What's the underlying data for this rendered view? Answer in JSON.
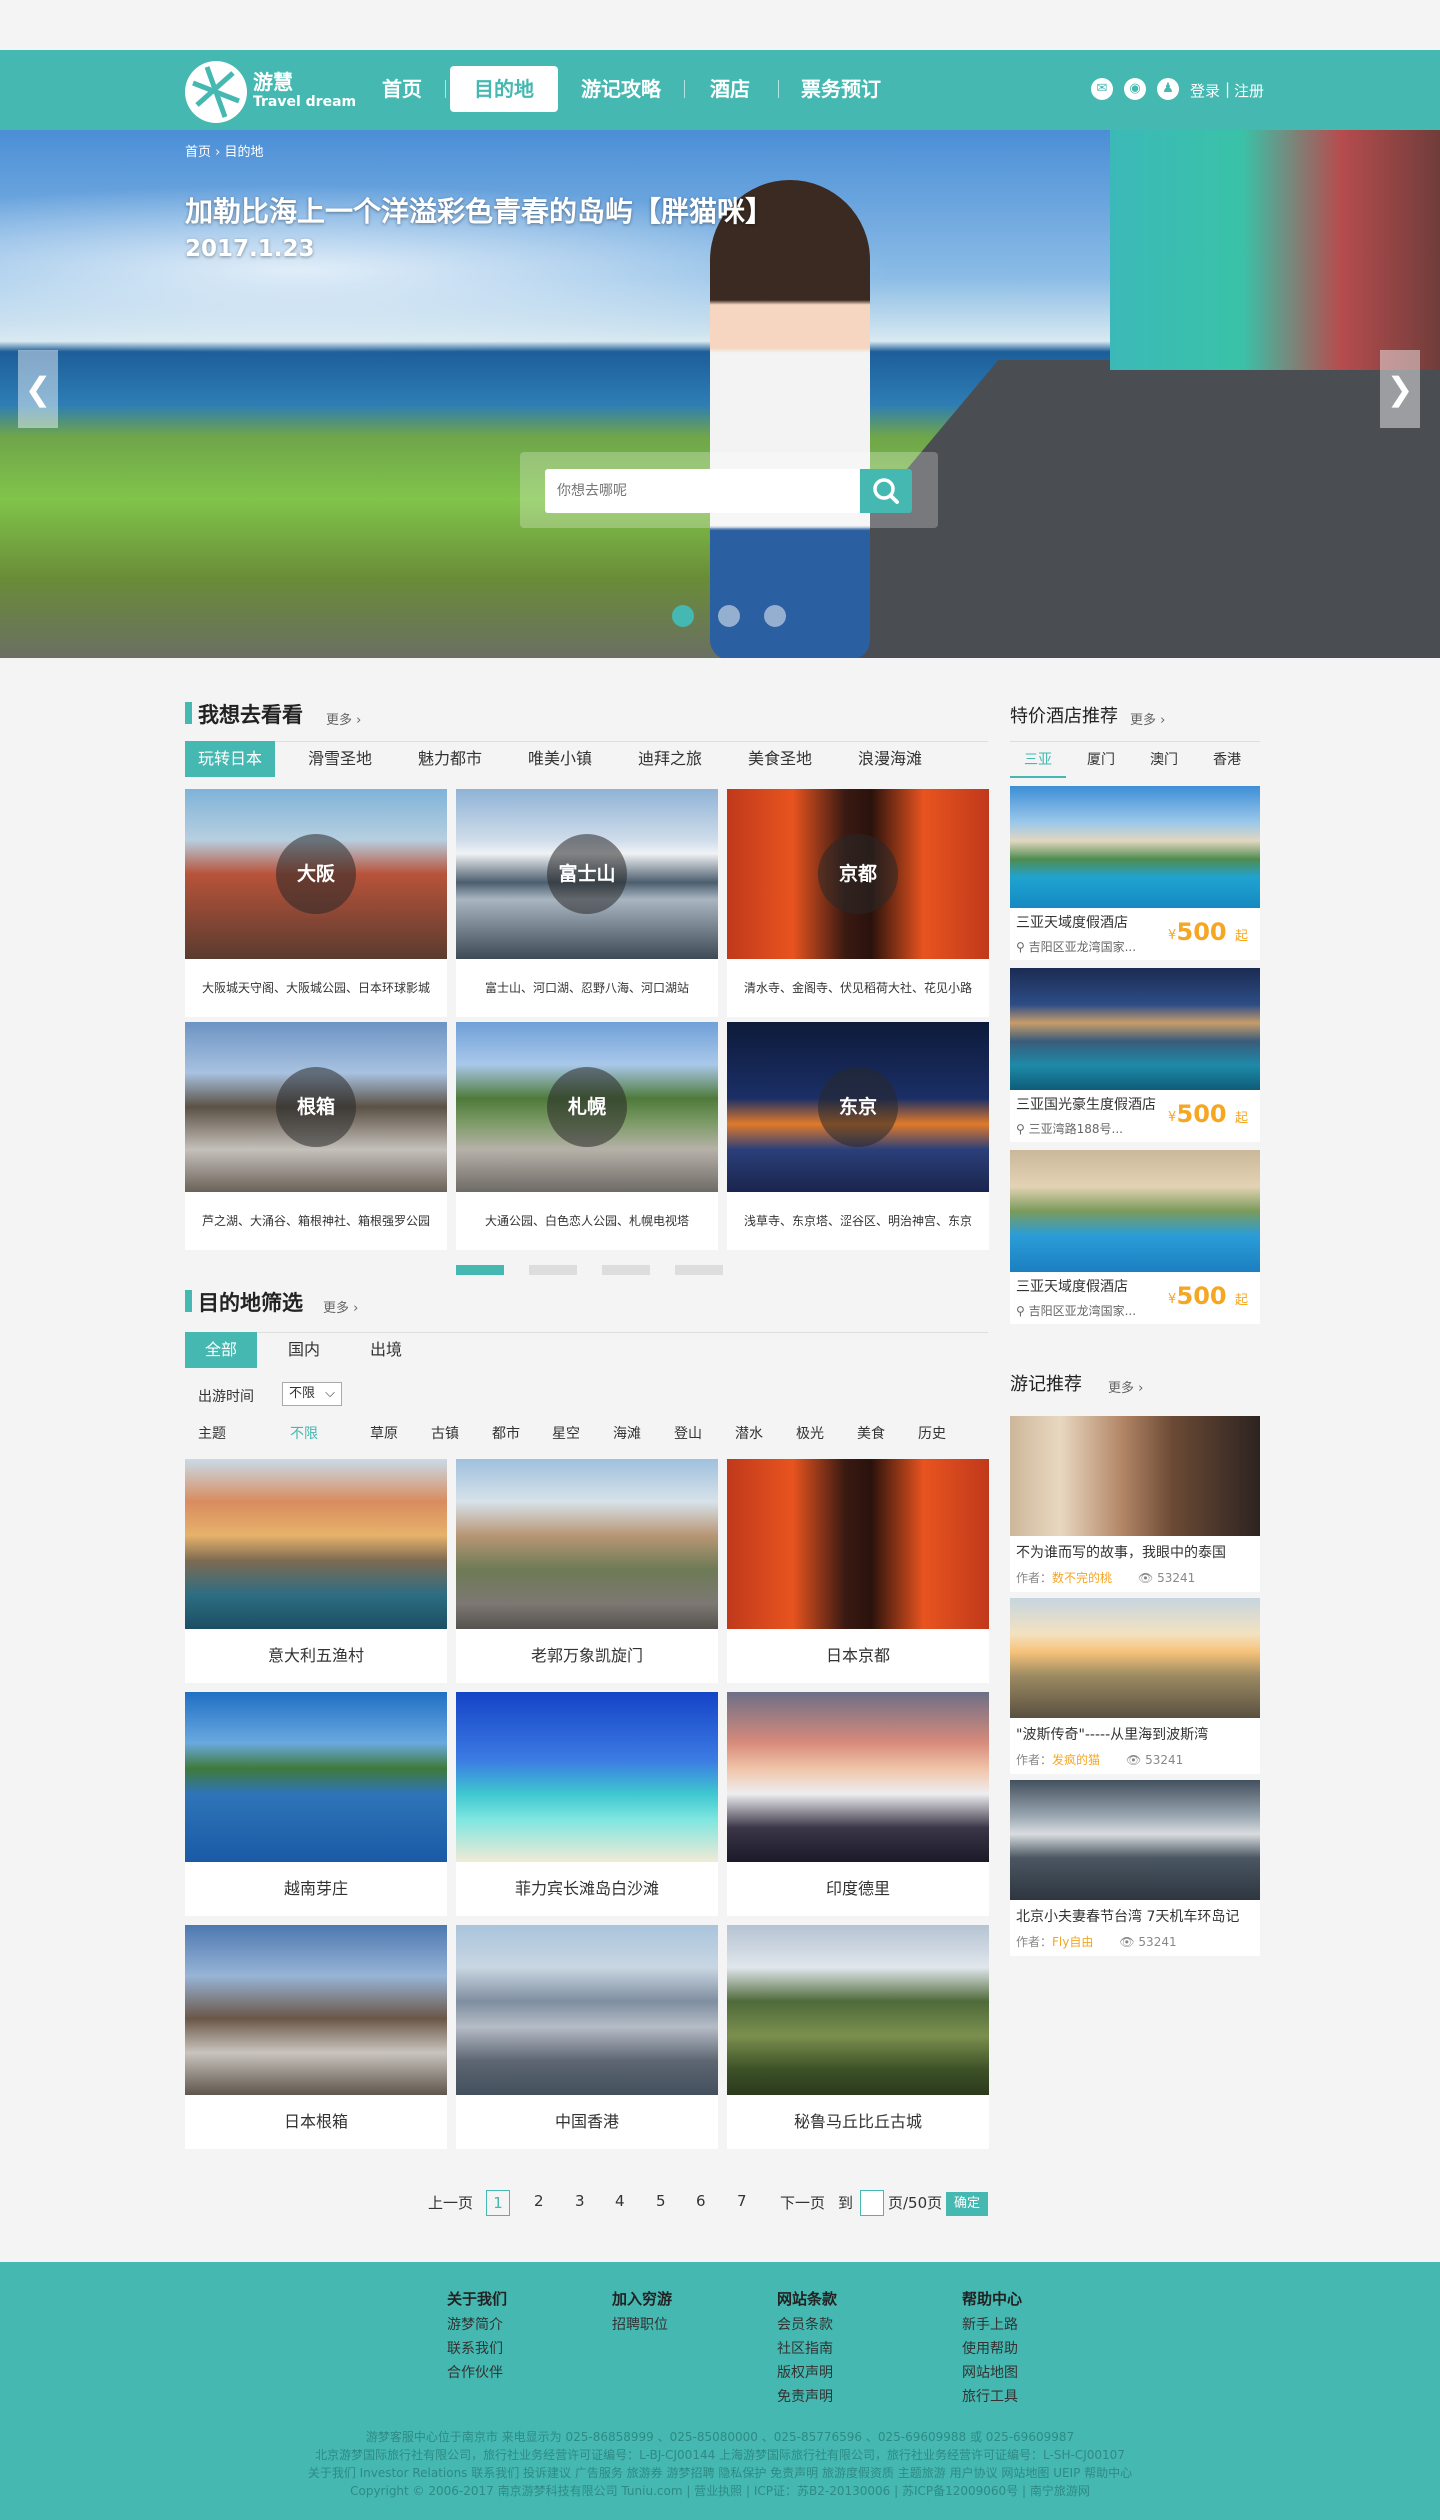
{
  "header": {
    "logo_text": "游慧",
    "logo_sub": "Travel dream",
    "nav": [
      "首页",
      "目的地",
      "游记攻略",
      "酒店",
      "票务预订"
    ],
    "login": "登录",
    "register": "注册",
    "sep": "|"
  },
  "hero": {
    "breadcrumb": "首页 › 目的地",
    "title": "加勒比海上一个洋溢彩色青春的岛屿【胖猫咪】",
    "date": "2017.1.23",
    "search_placeholder": "你想去哪呢",
    "arrow_left": "❮",
    "arrow_right": "❯"
  },
  "want": {
    "title": "我想去看看",
    "more": "更多 ›",
    "tabs": [
      "玩转日本",
      "滑雪圣地",
      "魅力都市",
      "唯美小镇",
      "迪拜之旅",
      "美食圣地",
      "浪漫海滩"
    ],
    "cards": [
      {
        "name": "大阪",
        "desc": "大阪城天守阁、大阪城公园、日本环球影城"
      },
      {
        "name": "富士山",
        "desc": "富士山、河口湖、忍野八海、河口湖站"
      },
      {
        "name": "京都",
        "desc": "清水寺、金阁寺、伏见稻荷大社、花见小路"
      },
      {
        "name": "根箱",
        "desc": "芦之湖、大涌谷、箱根神社、箱根强罗公园"
      },
      {
        "name": "札幌",
        "desc": "大通公园、白色恋人公园、札幌电视塔"
      },
      {
        "name": "东京",
        "desc": "浅草寺、东京塔、涩谷区、明治神宫、东京"
      }
    ]
  },
  "filter": {
    "title": "目的地筛选",
    "more": "更多 ›",
    "tabs": [
      "全部",
      "国内",
      "出境"
    ],
    "time_label": "出游时间",
    "time_value": "不限",
    "theme_label": "主题",
    "themes": [
      "不限",
      "草原",
      "古镇",
      "都市",
      "星空",
      "海滩",
      "登山",
      "潜水",
      "极光",
      "美食",
      "历史"
    ],
    "cards": [
      "意大利五渔村",
      "老郭万象凯旋门",
      "日本京都",
      "越南芽庄",
      "菲力宾长滩岛白沙滩",
      "印度德里",
      "日本根箱",
      "中国香港",
      "秘鲁马丘比丘古城"
    ]
  },
  "pagination": {
    "prev": "上一页",
    "pages": [
      "1",
      "2",
      "3",
      "4",
      "5",
      "6",
      "7"
    ],
    "next": "下一页",
    "goto": "到",
    "total": "页/50页",
    "ok": "确定"
  },
  "hotels": {
    "title": "特价酒店推荐",
    "more": "更多 ›",
    "tabs": [
      "三亚",
      "厦门",
      "澳门",
      "香港"
    ],
    "items": [
      {
        "name": "三亚天域度假酒店",
        "addr": "吉阳区亚龙湾国家...",
        "price": "500",
        "yen": "¥",
        "unit": "起"
      },
      {
        "name": "三亚国光豪生度假酒店",
        "addr": "三亚湾路188号...",
        "price": "500",
        "yen": "¥",
        "unit": "起"
      },
      {
        "name": "三亚天域度假酒店",
        "addr": "吉阳区亚龙湾国家...",
        "price": "500",
        "yen": "¥",
        "unit": "起"
      }
    ]
  },
  "notes": {
    "title": "游记推荐",
    "more": "更多 ›",
    "items": [
      {
        "title": "不为谁而写的故事，我眼中的泰国",
        "author_label": "作者：",
        "author": "数不完的桃",
        "views": "53241"
      },
      {
        "title": "\"波斯传奇\"-----从里海到波斯湾",
        "author_label": "作者：",
        "author": "发疯的猫",
        "views": "53241"
      },
      {
        "title": "北京小夫妻春节台湾 7天机车环岛记",
        "author_label": "作者：",
        "author": "Fly自由",
        "views": "53241"
      }
    ]
  },
  "footer": {
    "cols": [
      {
        "head": "关于我们",
        "links": [
          "游梦简介",
          "联系我们",
          "合作伙伴"
        ]
      },
      {
        "head": "加入穷游",
        "links": [
          "招聘职位"
        ]
      },
      {
        "head": "网站条款",
        "links": [
          "会员条款",
          "社区指南",
          "版权声明",
          "免责声明"
        ]
      },
      {
        "head": "帮助中心",
        "links": [
          "新手上路",
          "使用帮助",
          "网站地图",
          "旅行工具"
        ]
      }
    ],
    "copy": [
      "游梦客服中心位于南京市 来电显示为 025-86858999 、025-85080000 、025-85776596 、025-69609988 或 025-69609987",
      "北京游梦国际旅行社有限公司，旅行社业务经营许可证编号：L-BJ-CJ00144      上海游梦国际旅行社有限公司，旅行社业务经营许可证编号：L-SH-CJ00107",
      "关于我们 Investor Relations 联系我们 投诉建议 广告服务 旅游券 游梦招聘 隐私保护 免责声明 旅游度假资质 主题旅游 用户协议 网站地图 UEIP 帮助中心",
      "Copyright © 2006-2017 南京游梦科技有限公司 Tuniu.com | 营业执照 | ICP证：苏B2-20130006 | 苏ICP备12009060号 | 南宁旅游网"
    ]
  },
  "colors": {
    "accent": "#45b8b1",
    "price": "#f5a623"
  }
}
